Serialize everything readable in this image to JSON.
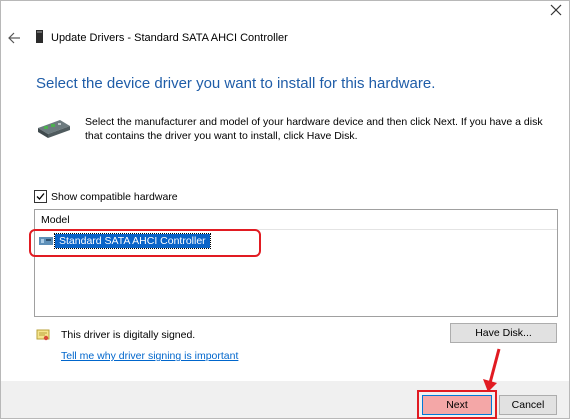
{
  "window": {
    "title": "Update Drivers - Standard SATA AHCI Controller"
  },
  "header": {
    "heading": "Select the device driver you want to install for this hardware.",
    "description": "Select the manufacturer and model of your hardware device and then click Next. If you have a disk that contains the driver you want to install, click Have Disk."
  },
  "options": {
    "show_compatible_label": "Show compatible hardware",
    "show_compatible_checked": true
  },
  "model_list": {
    "header": "Model",
    "items": [
      {
        "label": "Standard SATA AHCI Controller",
        "selected": true
      }
    ]
  },
  "signing": {
    "status_text": "This driver is digitally signed.",
    "link_text": "Tell me why driver signing is important"
  },
  "buttons": {
    "have_disk": "Have Disk...",
    "next": "Next",
    "cancel": "Cancel"
  },
  "colors": {
    "heading": "#1f5da8",
    "selection": "#0a64c8",
    "link": "#0066cc",
    "annotation": "#e11b22"
  },
  "icons": {
    "close": "close-icon",
    "back": "back-arrow-icon",
    "title": "device-icon",
    "hardware": "hardware-card-icon",
    "item": "controller-icon",
    "certificate": "certificate-icon"
  }
}
